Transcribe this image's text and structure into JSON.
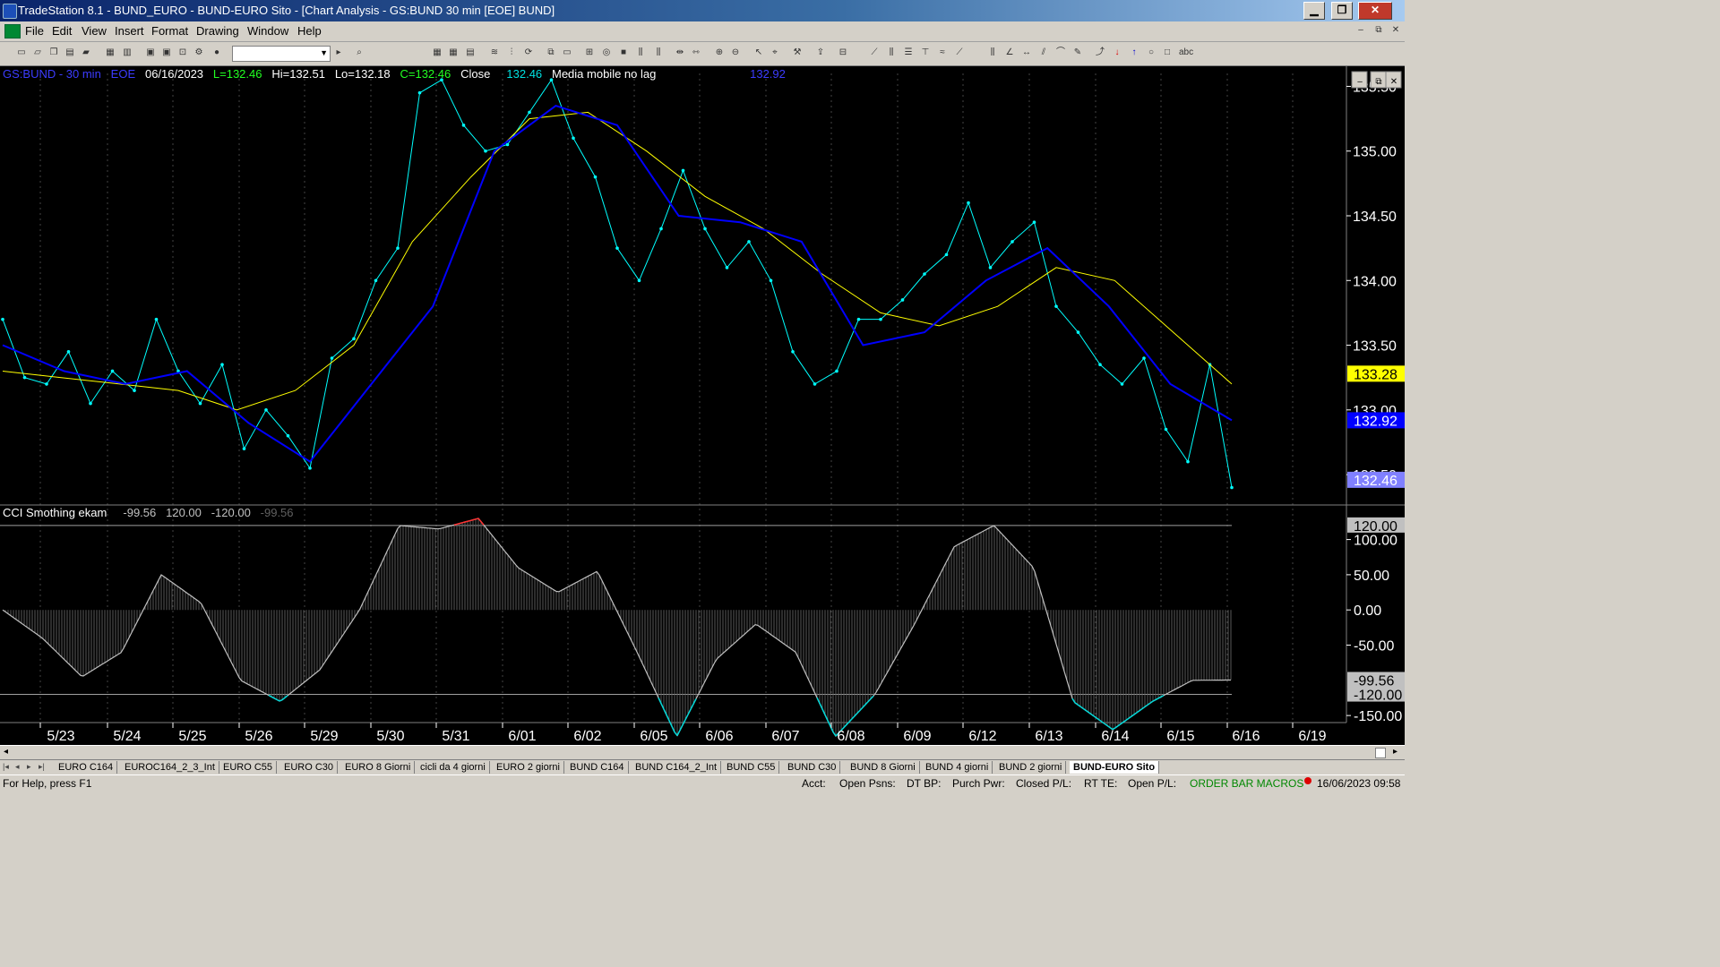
{
  "window": {
    "title": "TradeStation 8.1 - BUND_EURO - BUND-EURO Sito - [Chart Analysis - GS:BUND  30 min  [EOE] BUND]",
    "minimize": "▁",
    "restore": "❐",
    "close": "✕"
  },
  "menu": [
    "File",
    "Edit",
    "View",
    "Insert",
    "Format",
    "Drawing",
    "Window",
    "Help"
  ],
  "mdi_controls": [
    "‒",
    "⧉",
    "✕"
  ],
  "toolbar": {
    "icons": [
      "new-icon",
      "open-icon",
      "copy-icon",
      "paste-icon",
      "folder-icon",
      "print-icon",
      "print-preview-icon",
      "lock-icon",
      "gear-icon",
      "globe-icon"
    ],
    "combo_value": "",
    "tool_icons": [
      "zoom-in-icon",
      "zoom-out-icon",
      "pointer-icon",
      "cursor-icon",
      "tools-icon",
      "line-icon",
      "bars-icon",
      "fib-icon",
      "arrow-up-icon",
      "arrow-down-icon",
      "circle-icon",
      "rect-icon",
      "text-icon"
    ],
    "text_tool": "abc"
  },
  "chart": {
    "info": {
      "symbol": "GS:BUND - 30 min",
      "feed": "EOE",
      "date": "06/16/2023",
      "last": "L=132.46",
      "high": "Hi=132.51",
      "low": "Lo=132.18",
      "close": "C=132.46",
      "close_label": "Close",
      "close_value": "132.46",
      "ma_label": "Media mobile no lag",
      "ma_value": "132.92"
    },
    "indicator_info": {
      "label": "CCI Smothing ekam",
      "v1": "-99.56",
      "v2": "120.00",
      "v3": "-120.00",
      "v4": "-99.56"
    },
    "price_axis": [
      "135.50",
      "135.00",
      "134.50",
      "134.00",
      "133.50",
      "133.00",
      "132.50"
    ],
    "price_tags": {
      "yellow": "133.28",
      "blue": "132.92",
      "lilac": "132.46"
    },
    "cci_axis": [
      "100.00",
      "50.00",
      "0.00",
      "-50.00",
      "-150.00"
    ],
    "cci_tags": {
      "upper": "120.00",
      "last": "-99.56",
      "lower": "-120.00"
    },
    "dates": [
      "5/23",
      "5/24",
      "5/25",
      "5/26",
      "5/29",
      "5/30",
      "5/31",
      "6/01",
      "6/02",
      "6/05",
      "6/06",
      "6/07",
      "6/08",
      "6/09",
      "6/12",
      "6/13",
      "6/14",
      "6/15",
      "6/16",
      "6/19"
    ],
    "colors": {
      "price": "#00ffff",
      "ma_fast": "#ffff00",
      "ma_slow": "#0000ff",
      "cci": "#c0c0c0",
      "cci_over": "#ff3030",
      "cci_under": "#00d8d8"
    }
  },
  "chart_data": {
    "type": "line",
    "title": "GS:BUND - 30 min",
    "x_labels": [
      "5/23",
      "5/24",
      "5/25",
      "5/26",
      "5/29",
      "5/30",
      "5/31",
      "6/01",
      "6/02",
      "6/05",
      "6/06",
      "6/07",
      "6/08",
      "6/09",
      "6/12",
      "6/13",
      "6/14",
      "6/15",
      "6/16"
    ],
    "ylim": [
      132.3,
      135.6
    ],
    "series": [
      {
        "name": "Close",
        "color": "#00ffff",
        "values": [
          133.7,
          133.25,
          133.2,
          133.45,
          133.05,
          133.3,
          133.15,
          133.7,
          133.3,
          133.05,
          133.35,
          132.7,
          133.0,
          132.8,
          132.55,
          133.4,
          133.55,
          134.0,
          134.25,
          135.45,
          135.55,
          135.2,
          135.0,
          135.05,
          135.3,
          135.55,
          135.1,
          134.8,
          134.25,
          134.0,
          134.4,
          134.85,
          134.4,
          134.1,
          134.3,
          134.0,
          133.45,
          133.2,
          133.3,
          133.7,
          133.7,
          133.85,
          134.05,
          134.2,
          134.6,
          134.1,
          134.3,
          134.45,
          133.8,
          133.6,
          133.35,
          133.2,
          133.4,
          132.85,
          132.6,
          133.35,
          132.4
        ]
      },
      {
        "name": "Media mobile no lag",
        "color": "#ffff00",
        "values": [
          133.3,
          133.25,
          133.2,
          133.15,
          133.0,
          133.15,
          133.5,
          134.3,
          134.8,
          135.25,
          135.3,
          135.0,
          134.65,
          134.4,
          134.05,
          133.75,
          133.65,
          133.8,
          134.1,
          134.0,
          133.6,
          133.2
        ]
      },
      {
        "name": "Media mobile",
        "color": "#0000ff",
        "values": [
          133.5,
          133.3,
          133.2,
          133.3,
          132.9,
          132.6,
          133.2,
          133.8,
          135.0,
          135.35,
          135.2,
          134.5,
          134.45,
          134.3,
          133.5,
          133.6,
          134.0,
          134.25,
          133.8,
          133.2,
          132.92
        ]
      }
    ]
  },
  "cci_data": {
    "type": "area",
    "title": "CCI Smothing ekam",
    "ylim": [
      -160,
      130
    ],
    "levels": [
      120,
      -120
    ],
    "values": [
      0,
      -40,
      -95,
      -60,
      50,
      10,
      -100,
      -130,
      -85,
      0,
      120,
      115,
      130,
      60,
      25,
      55,
      -60,
      -180,
      -70,
      -20,
      -60,
      -180,
      -120,
      -20,
      90,
      120,
      60,
      -130,
      -170,
      -130,
      -100,
      -99.56
    ]
  },
  "scroll": {
    "left": "◂",
    "right": "▸"
  },
  "tabs": {
    "nav": [
      "|◂",
      "◂",
      "▸",
      "▸|"
    ],
    "items": [
      "EURO C164",
      "EUROC164_2_3_Int",
      "EURO C55",
      "EURO C30",
      "EURO 8 Giorni",
      "cicli da 4 giorni",
      "EURO 2 giorni",
      "BUND C164",
      "BUND C164_2_Int",
      "BUND C55",
      "BUND  C30",
      "BUND 8 Giorni",
      "BUND 4 giorni",
      "BUND 2 giorni",
      "BUND-EURO Sito"
    ],
    "active": "BUND-EURO Sito"
  },
  "status": {
    "help": "For Help, press F1",
    "acct": "Acct:",
    "open_psns": "Open Psns:",
    "dt_bp": "DT BP:",
    "purch_pwr": "Purch Pwr:",
    "closed_pl": "Closed P/L:",
    "rt_te": "RT TE:",
    "open_pl": "Open P/L:",
    "macros": "ORDER BAR  MACROS",
    "datetime": "16/06/2023 09:58"
  }
}
